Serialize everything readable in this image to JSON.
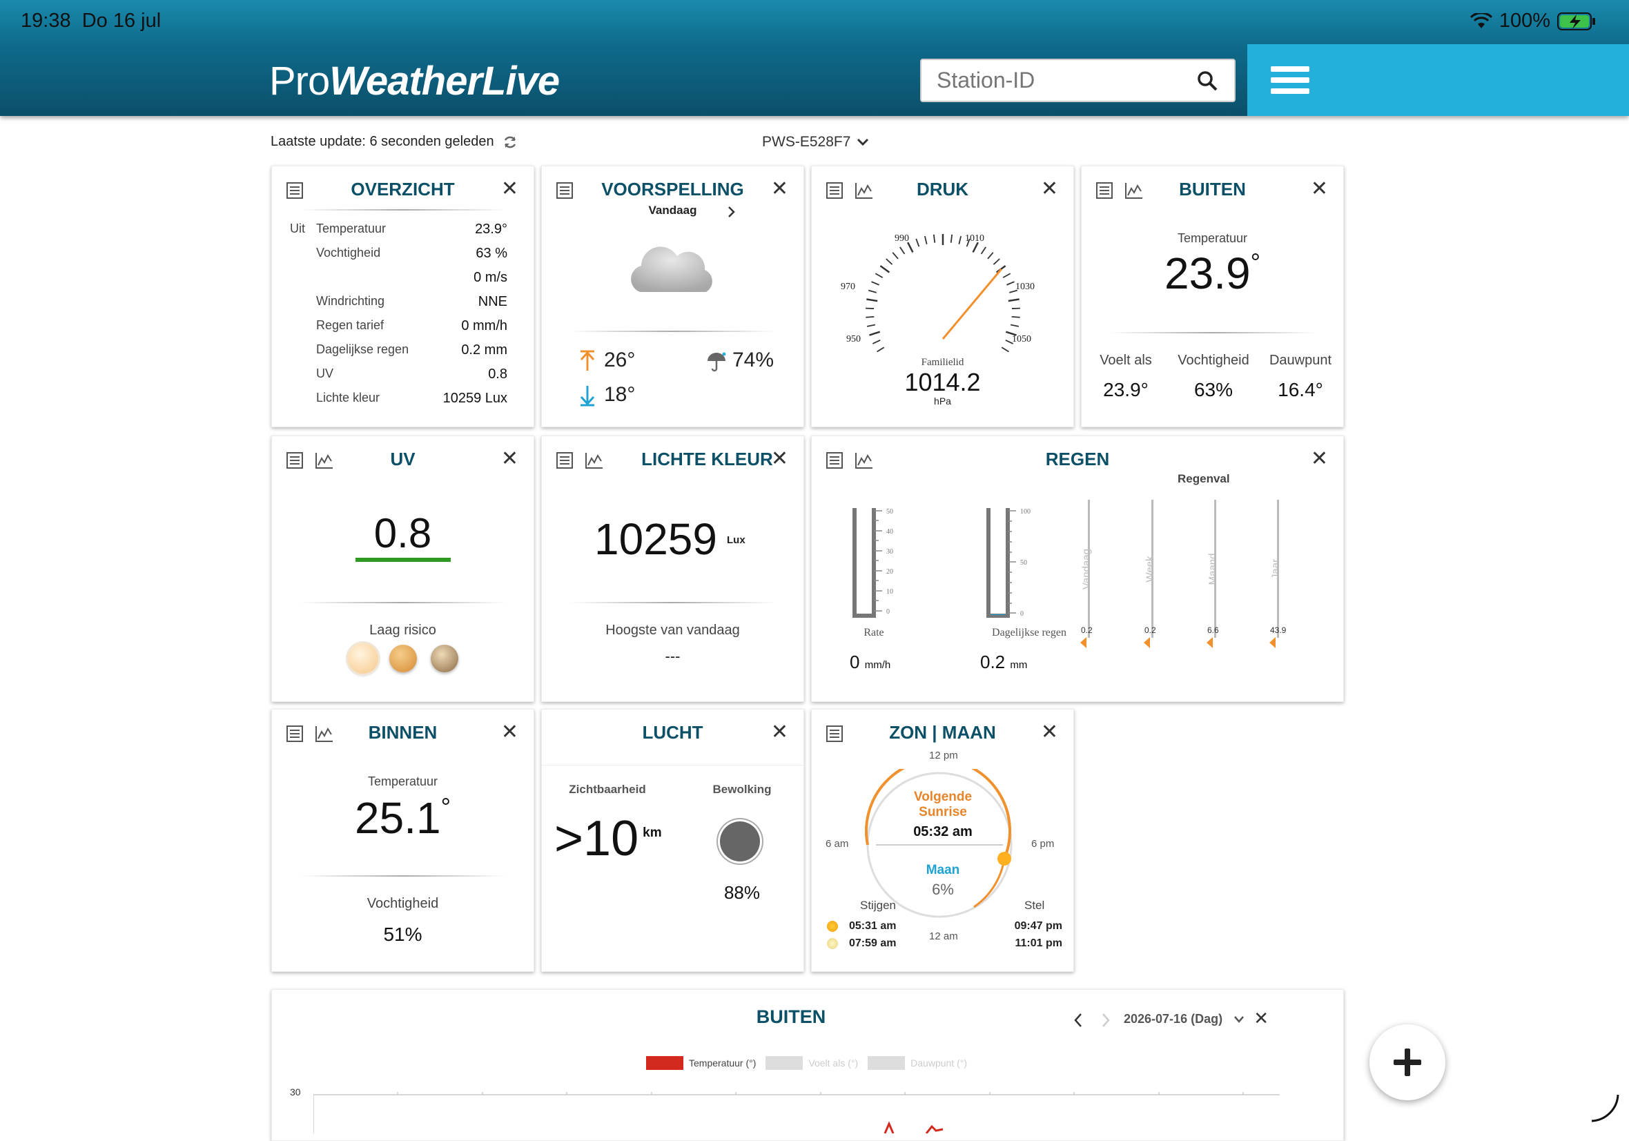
{
  "status": {
    "time": "19:38",
    "date": "Do 16 jul",
    "battery": "100%"
  },
  "header": {
    "logo_light": "Pro",
    "logo_bold": "WeatherLive",
    "search_placeholder": "Station-ID"
  },
  "toolbar": {
    "last_update": "Laatste update: 6 seconden geleden",
    "station": "PWS-E528F7"
  },
  "overview": {
    "title": "OVERZICHT",
    "prefix": "Uit",
    "rows": [
      {
        "label": "Temperatuur",
        "value": "23.9°"
      },
      {
        "label": "Vochtigheid",
        "value": "63 %"
      },
      {
        "label": "",
        "value": "0 m/s"
      },
      {
        "label": "Windrichting",
        "value": "NNE"
      },
      {
        "label": "Regen tarief",
        "value": "0 mm/h"
      },
      {
        "label": "Dagelijkse regen",
        "value": "0.2 mm"
      },
      {
        "label": "UV",
        "value": "0.8"
      },
      {
        "label": "Lichte kleur",
        "value": "10259 Lux"
      }
    ]
  },
  "forecast": {
    "title": "VOORSPELLING",
    "day": "Vandaag",
    "high": "26°",
    "low": "18°",
    "rain_chance": "74%"
  },
  "pressure": {
    "title": "DRUK",
    "ticks": [
      "950",
      "970",
      "990",
      "1010",
      "1030",
      "1050"
    ],
    "caption": "Familielid",
    "value": "1014.2",
    "unit": "hPa",
    "min": 950,
    "max": 1050,
    "reading": 1014.2
  },
  "outside": {
    "title": "BUITEN",
    "temp_label": "Temperatuur",
    "temp": "23.9",
    "deg": "°",
    "stats": [
      {
        "label": "Voelt als",
        "value": "23.9°"
      },
      {
        "label": "Vochtigheid",
        "value": "63%"
      },
      {
        "label": "Dauwpunt",
        "value": "16.4°"
      }
    ]
  },
  "uv": {
    "title": "UV",
    "value": "0.8",
    "risk": "Laag risico"
  },
  "light": {
    "title": "LICHTE KLEUR",
    "value": "10259",
    "unit": "Lux",
    "max_label": "Hoogste van vandaag",
    "max_value": "---"
  },
  "rain": {
    "title": "REGEN",
    "rainfall_label": "Regenval",
    "rate": {
      "label": "Rate",
      "value": "0",
      "unit": "mm/h",
      "ticks": [
        "50",
        "40",
        "30",
        "20",
        "10",
        "0"
      ]
    },
    "daily": {
      "label": "Dagelijkse regen",
      "value": "0.2",
      "unit": "mm",
      "ticks": [
        "100",
        "50",
        "0"
      ]
    },
    "bars": [
      {
        "label": "Vandaag",
        "value": "0.2"
      },
      {
        "label": "Week",
        "value": "0.2"
      },
      {
        "label": "Maand",
        "value": "6.6"
      },
      {
        "label": "Jaar",
        "value": "43.9"
      }
    ]
  },
  "inside": {
    "title": "BINNEN",
    "temp_label": "Temperatuur",
    "temp": "25.1",
    "deg": "°",
    "hum_label": "Vochtigheid",
    "hum": "51%"
  },
  "sky": {
    "title": "LUCHT",
    "vis_label": "Zichtbaarheid",
    "vis_value": ">10",
    "vis_unit": "km",
    "cloud_label": "Bewolking",
    "cloud_value": "88%"
  },
  "sun": {
    "title": "ZON | MAAN",
    "noon": "12 pm",
    "midnight": "12 am",
    "am": "6 am",
    "pm": "6 pm",
    "next_label": "Volgende",
    "next_event": "Sunrise",
    "next_time": "05:32 am",
    "moon_label": "Maan",
    "moon_value": "6%",
    "rise_label": "Stijgen",
    "set_label": "Stel",
    "sun_rise": "05:31 am",
    "moon_rise": "07:59 am",
    "sun_set": "09:47 pm",
    "moon_set": "11:01 pm"
  },
  "graph": {
    "title": "BUITEN",
    "date": "2026-07-16 (Dag)",
    "chart_data": {
      "type": "line",
      "series": [
        {
          "name": "Temperatuur (°)"
        },
        {
          "name": "Voelt als (°)"
        },
        {
          "name": "Dauwpunt (°)"
        }
      ],
      "ytick_top": "30"
    }
  }
}
